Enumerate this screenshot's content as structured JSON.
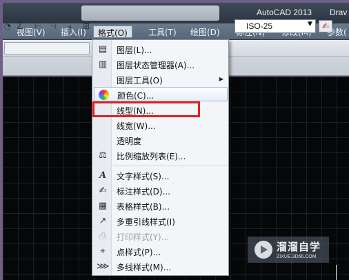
{
  "titlebar": {
    "app_title": "AutoCAD 2013",
    "doc_title": "Drav"
  },
  "menubar": {
    "items": [
      {
        "label": "视图(V)"
      },
      {
        "label": "插入(I)"
      },
      {
        "label": "格式(O)",
        "active": true
      },
      {
        "label": "工具(T)"
      },
      {
        "label": "绘图(D)"
      },
      {
        "label": "标注(N)"
      },
      {
        "label": "修改(M)"
      },
      {
        "label": "参数("
      }
    ]
  },
  "toolbar": {
    "dimstyle_value": "ISO-25",
    "icons": [
      "circle-arc-icon",
      "angle-icon",
      "dim-linear-icon",
      "dim-aligned-icon",
      "dim-baseline-icon",
      "dim-continue-icon"
    ]
  },
  "format_menu": {
    "items": [
      {
        "label": "图层(L)...",
        "icon": "layer-icon"
      },
      {
        "label": "图层状态管理器(A)...",
        "icon": "layer-state-icon"
      },
      {
        "label": "图层工具(O)",
        "icon": "",
        "submenu": true
      },
      {
        "label": "颜色(C)...",
        "icon": "color-wheel-icon",
        "hover": true
      },
      {
        "label": "线型(N)...",
        "icon": "",
        "highlighted": true
      },
      {
        "label": "线宽(W)...",
        "icon": ""
      },
      {
        "label": "透明度",
        "icon": ""
      },
      {
        "label": "比例缩放列表(E)...",
        "icon": "scale-list-icon"
      },
      {
        "label": "文字样式(S)...",
        "icon": "text-style-icon"
      },
      {
        "label": "标注样式(D)...",
        "icon": "dim-style-icon"
      },
      {
        "label": "表格样式(B)...",
        "icon": "table-style-icon"
      },
      {
        "label": "多重引线样式(I)",
        "icon": "mleader-style-icon"
      },
      {
        "label": "打印样式(Y)...",
        "icon": "plot-style-icon",
        "disabled": true
      },
      {
        "label": "点样式(P)...",
        "icon": "point-style-icon"
      },
      {
        "label": "多线样式(M)...",
        "icon": "mline-style-icon"
      }
    ]
  },
  "watermark": {
    "title": "溜溜自学",
    "url": "ZIXUE.3D66.COM"
  }
}
